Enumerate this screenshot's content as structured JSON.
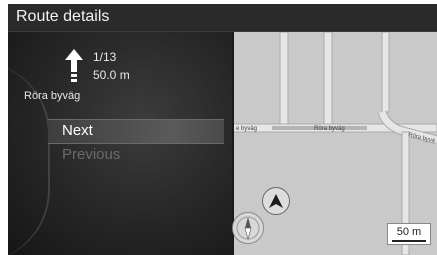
{
  "header": {
    "title": "Route details"
  },
  "instruction": {
    "step": "1/13",
    "distance": "50.0 m",
    "street": "Röra byväg",
    "icon": "turn-straight-arrow-icon"
  },
  "menu": {
    "next_label": "Next",
    "previous_label": "Previous"
  },
  "map": {
    "road_labels": [
      "e byväg",
      "Röra byväg",
      "Röra byvä"
    ],
    "scale_label": "50 m",
    "compass_icon": "compass-icon",
    "position_icon": "vehicle-position-icon"
  },
  "colors": {
    "title_text": "#f2f2f2",
    "selected_item": "#5a5a5a",
    "disabled_text": "#6a6a6a",
    "map_background": "#c9c9c9",
    "road": "#e6e6e6"
  }
}
